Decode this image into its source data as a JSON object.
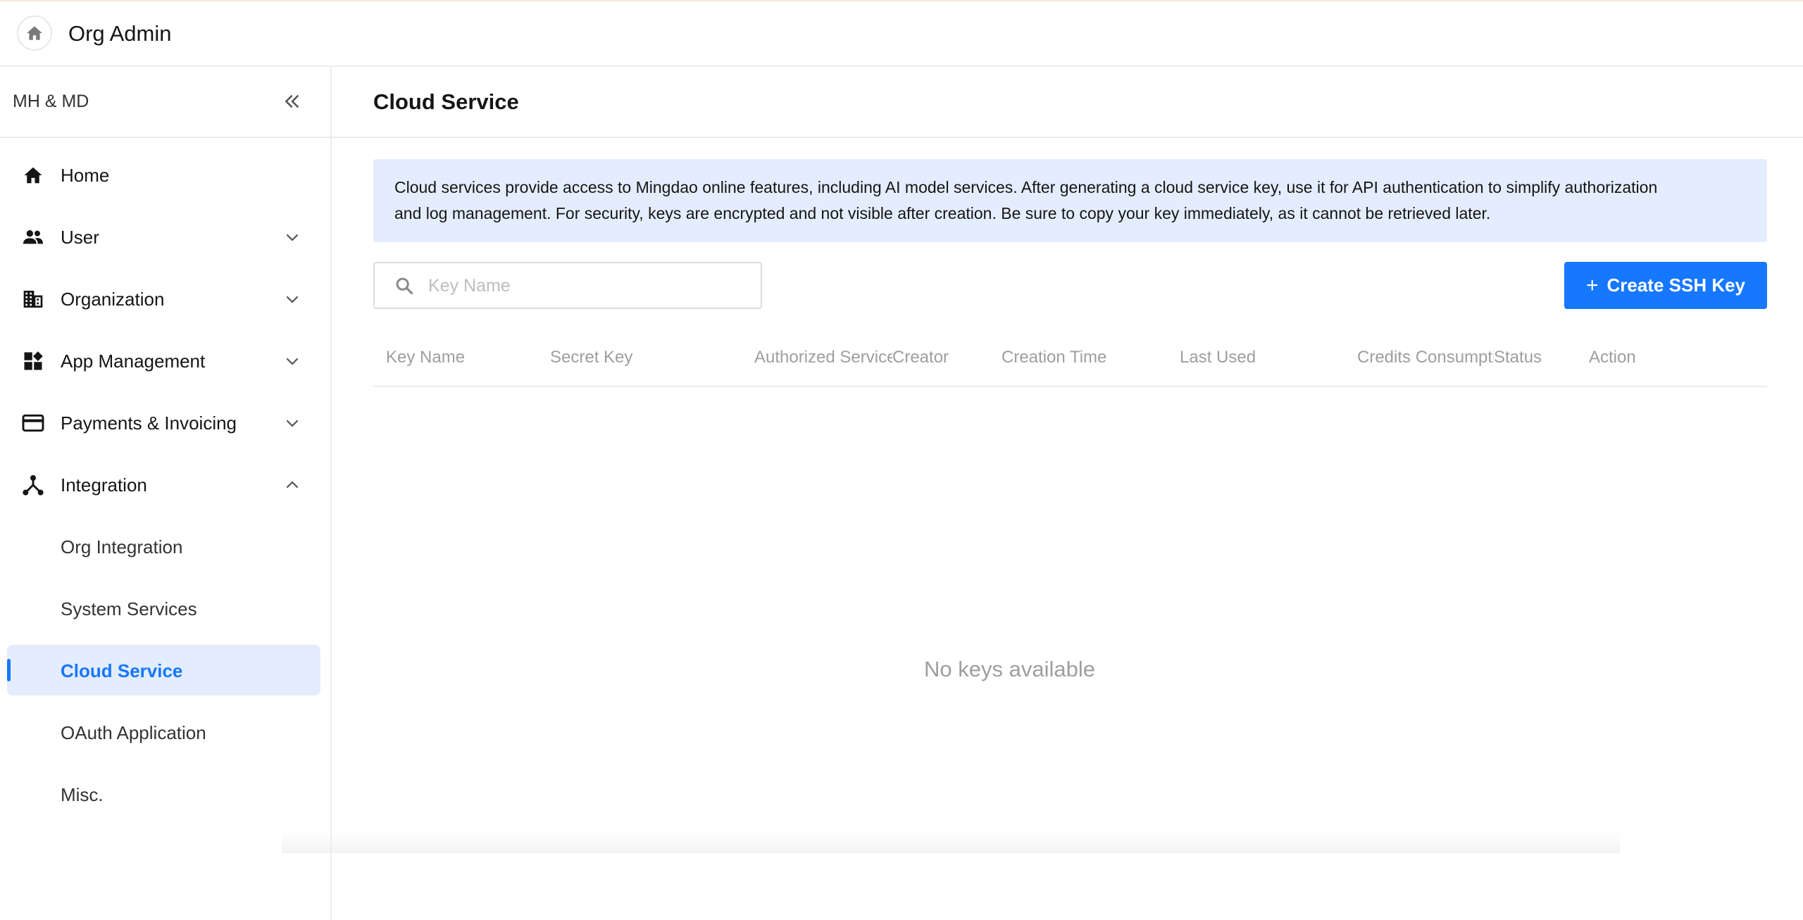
{
  "header": {
    "title": "Org Admin",
    "home_icon": "home-icon"
  },
  "sidebar": {
    "company": "MH & MD",
    "collapse_icon": "double-chevron-left-icon",
    "items": [
      {
        "label": "Home",
        "icon": "home-icon"
      },
      {
        "label": "User",
        "icon": "users-icon",
        "expandable": true,
        "expanded": false
      },
      {
        "label": "Organization",
        "icon": "building-icon",
        "expandable": true,
        "expanded": false
      },
      {
        "label": "App Management",
        "icon": "apps-icon",
        "expandable": true,
        "expanded": false
      },
      {
        "label": "Payments & Invoicing",
        "icon": "credit-card-icon",
        "expandable": true,
        "expanded": false
      },
      {
        "label": "Integration",
        "icon": "integration-icon",
        "expandable": true,
        "expanded": true
      }
    ],
    "sub_items": [
      {
        "label": "Org Integration"
      },
      {
        "label": "System Services"
      },
      {
        "label": "Cloud Service",
        "active": true
      },
      {
        "label": "OAuth Application"
      },
      {
        "label": "Misc."
      }
    ]
  },
  "main": {
    "title": "Cloud Service",
    "notice_line1": "Cloud services provide access to Mingdao online features, including AI model services. After generating a cloud service key, use it for API authentication to simplify authorization",
    "notice_line2": "and log management. For security, keys are encrypted and not visible after creation. Be sure to copy your key immediately, as it cannot be retrieved later.",
    "search_placeholder": "Key Name",
    "create_button": "Create SSH Key",
    "columns": [
      "Key Name",
      "Secret Key",
      "Authorized Services",
      "Creator",
      "Creation Time",
      "Last Used",
      "Credits Consumption",
      "Status",
      "Action"
    ],
    "empty_text": "No keys available"
  },
  "colors": {
    "accent": "#1677ff",
    "active_bg": "#e3edfd",
    "notice_bg": "#e3edfd",
    "muted_text": "#9e9e9e"
  }
}
